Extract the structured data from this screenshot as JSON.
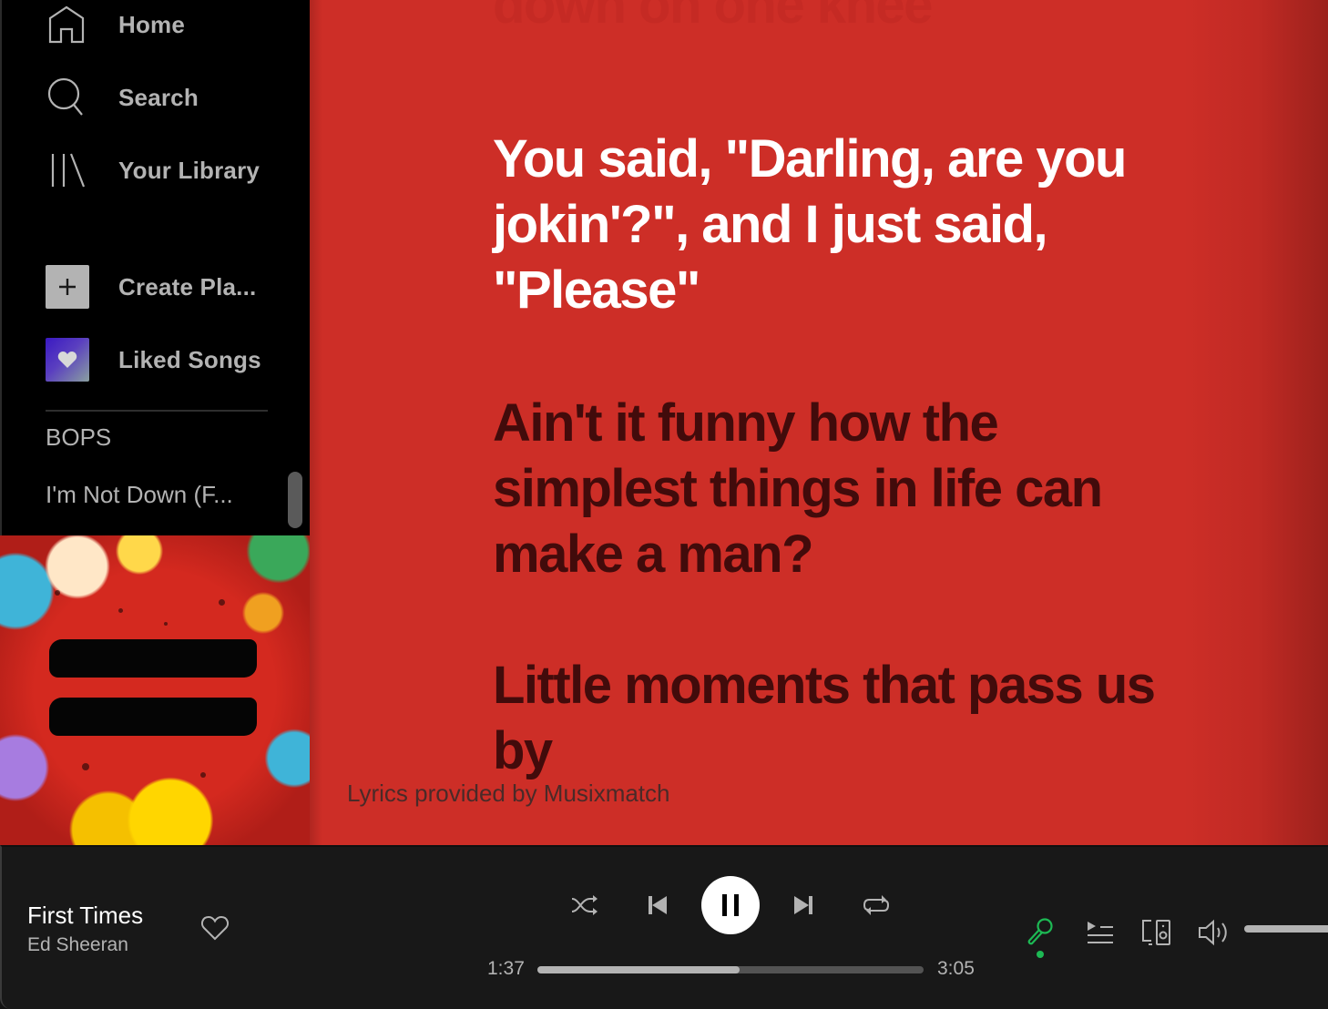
{
  "sidebar": {
    "nav": [
      {
        "label": "Home",
        "icon": "home-icon"
      },
      {
        "label": "Search",
        "icon": "search-icon"
      },
      {
        "label": "Your Library",
        "icon": "library-icon"
      }
    ],
    "actions": [
      {
        "label": "Create Pla...",
        "icon": "plus-icon"
      },
      {
        "label": "Liked Songs",
        "icon": "heart-icon"
      }
    ],
    "section_label": "BOPS",
    "playlists": [
      "I'm Not Down (F..."
    ]
  },
  "album": {
    "alt": "= (Equals) album cover"
  },
  "lyrics": {
    "past_line": "down on one knee",
    "active_line": "You said, \"Darling, are you jokin'?\", and I just said, \"Please\"",
    "upcoming_lines": [
      "Ain't it funny how the simplest things in life can make a man?",
      "Little moments that pass us by"
    ],
    "attribution": "Lyrics provided by Musixmatch",
    "background_color": "#cd2e27",
    "active_color": "#ffffff",
    "upcoming_color": "#420b0b"
  },
  "player": {
    "track_title": "First Times",
    "track_artist": "Ed Sheeran",
    "liked": false,
    "current_time": "1:37",
    "total_time": "3:05",
    "progress_fraction": 0.524,
    "volume_fraction": 1.0,
    "is_playing": true,
    "lyrics_active": true,
    "accent_color": "#1db954",
    "controls": [
      "shuffle-icon",
      "previous-icon",
      "pause-icon",
      "next-icon",
      "repeat-icon"
    ],
    "right_controls": [
      "lyrics-icon",
      "queue-icon",
      "devices-icon",
      "volume-icon"
    ]
  }
}
